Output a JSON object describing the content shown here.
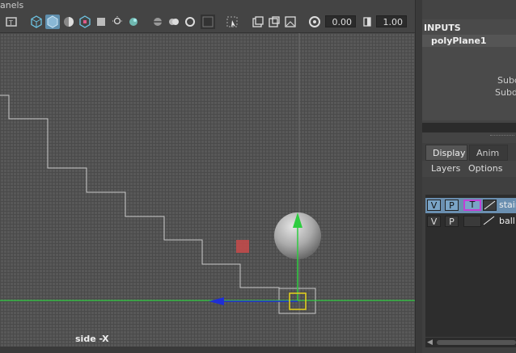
{
  "menu": {
    "label": "anels"
  },
  "toolbar": {
    "icons": [
      "camera-icon",
      "wireframe-cube-icon",
      "shaded-cube-icon",
      "smooth-shade-icon",
      "textured-icon",
      "light-icon",
      "shadow-icon",
      "ambient-occlusion-icon",
      "motion-blur-icon",
      "antialias-icon",
      "grid-toggle-icon",
      "isolate-select-icon",
      "xray-icon",
      "xray-joints-icon",
      "xray-active-icon",
      "exposure-icon",
      "gamma-icon"
    ],
    "exposure_value": "0.00",
    "gamma_value": "1.00"
  },
  "viewport": {
    "camera_label": "side -X"
  },
  "channel_box": {
    "inputs_title": "INPUTS",
    "node_name": "polyPlane1",
    "attr_1": "Subc",
    "attr_2": "Subd"
  },
  "layer_editor": {
    "tabs": [
      {
        "label": "Display",
        "active": true
      },
      {
        "label": "Anim",
        "active": false
      }
    ],
    "menu": [
      "Layers",
      "Options"
    ],
    "layers": [
      {
        "v": "V",
        "p": "P",
        "t": "T",
        "name": "stair",
        "selected": true
      },
      {
        "v": "V",
        "p": "P",
        "t": "",
        "name": "ball",
        "selected": false
      }
    ]
  },
  "colors": {
    "selected_layer": "#6a8fb0",
    "template_highlight": "#c13fd6",
    "axis_green": "#2ecc40",
    "axis_blue": "#1f2fd6",
    "manipulator_yellow": "#e6d21a",
    "marker_red": "#c84a4a"
  }
}
